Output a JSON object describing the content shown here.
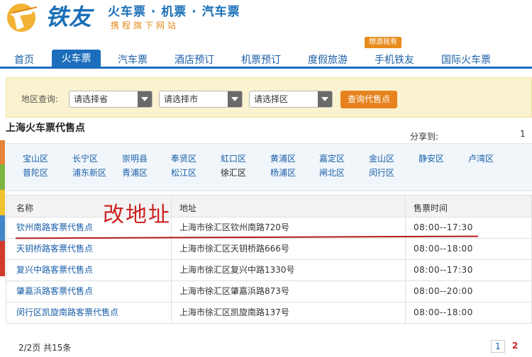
{
  "brand": {
    "logo_text": "铁友",
    "slogan": "火车票 · 机票 · 汽车票",
    "subslogan": "携程旗下网站"
  },
  "nav": {
    "items": [
      "首页",
      "火车票",
      "汽车票",
      "酒店预订",
      "机票预订",
      "度假旅游",
      "手机铁友",
      "国际火车票"
    ],
    "active_index": 1,
    "badge": "想游就有"
  },
  "search": {
    "label": "地区查询:",
    "province_placeholder": "请选择省",
    "city_placeholder": "请选择市",
    "district_placeholder": "请选择区",
    "button": "查询代售点"
  },
  "page": {
    "title": "上海火车票代售点",
    "share_label": "分享到:",
    "share_count": "1"
  },
  "districts": {
    "row1": [
      "宝山区",
      "长宁区",
      "崇明县",
      "奉贤区",
      "虹口区",
      "黄浦区",
      "嘉定区",
      "金山区",
      "静安区",
      "卢湾区"
    ],
    "row2": [
      "普陀区",
      "浦东新区",
      "青浦区",
      "松江区",
      "徐汇区",
      "杨浦区",
      "闸北区",
      "闵行区"
    ],
    "active": "徐汇区"
  },
  "table": {
    "headers": [
      "名称",
      "地址",
      "售票时间"
    ],
    "rows": [
      {
        "name": "钦州南路客票代售点",
        "address": "上海市徐汇区钦州南路720号",
        "hours": "08:00--17:30"
      },
      {
        "name": "天钥桥路客票代售点",
        "address": "上海市徐汇区天钥桥路666号",
        "hours": "08:00--18:00"
      },
      {
        "name": "复兴中路客票代售点",
        "address": "上海市徐汇区复兴中路1330号",
        "hours": "08:00--17:30"
      },
      {
        "name": "肇嘉浜路客票代售点",
        "address": "上海市徐汇区肇嘉浜路873号",
        "hours": "08:00--20:00"
      },
      {
        "name": "闵行区凯旋南路客票代售点",
        "address": "上海市徐汇区凯旋南路137号",
        "hours": "08:00--18:00"
      }
    ]
  },
  "annotation": "改地址",
  "pagination": {
    "summary": "2/2页 共15条",
    "pages": [
      "1",
      "2"
    ]
  },
  "colors": {
    "brand_blue": "#1a6fb7",
    "nav_active": "#1c6ebd",
    "accent_orange": "#e6831f",
    "annotation_red": "#cc2222",
    "search_bg": "#fbf3cf"
  }
}
